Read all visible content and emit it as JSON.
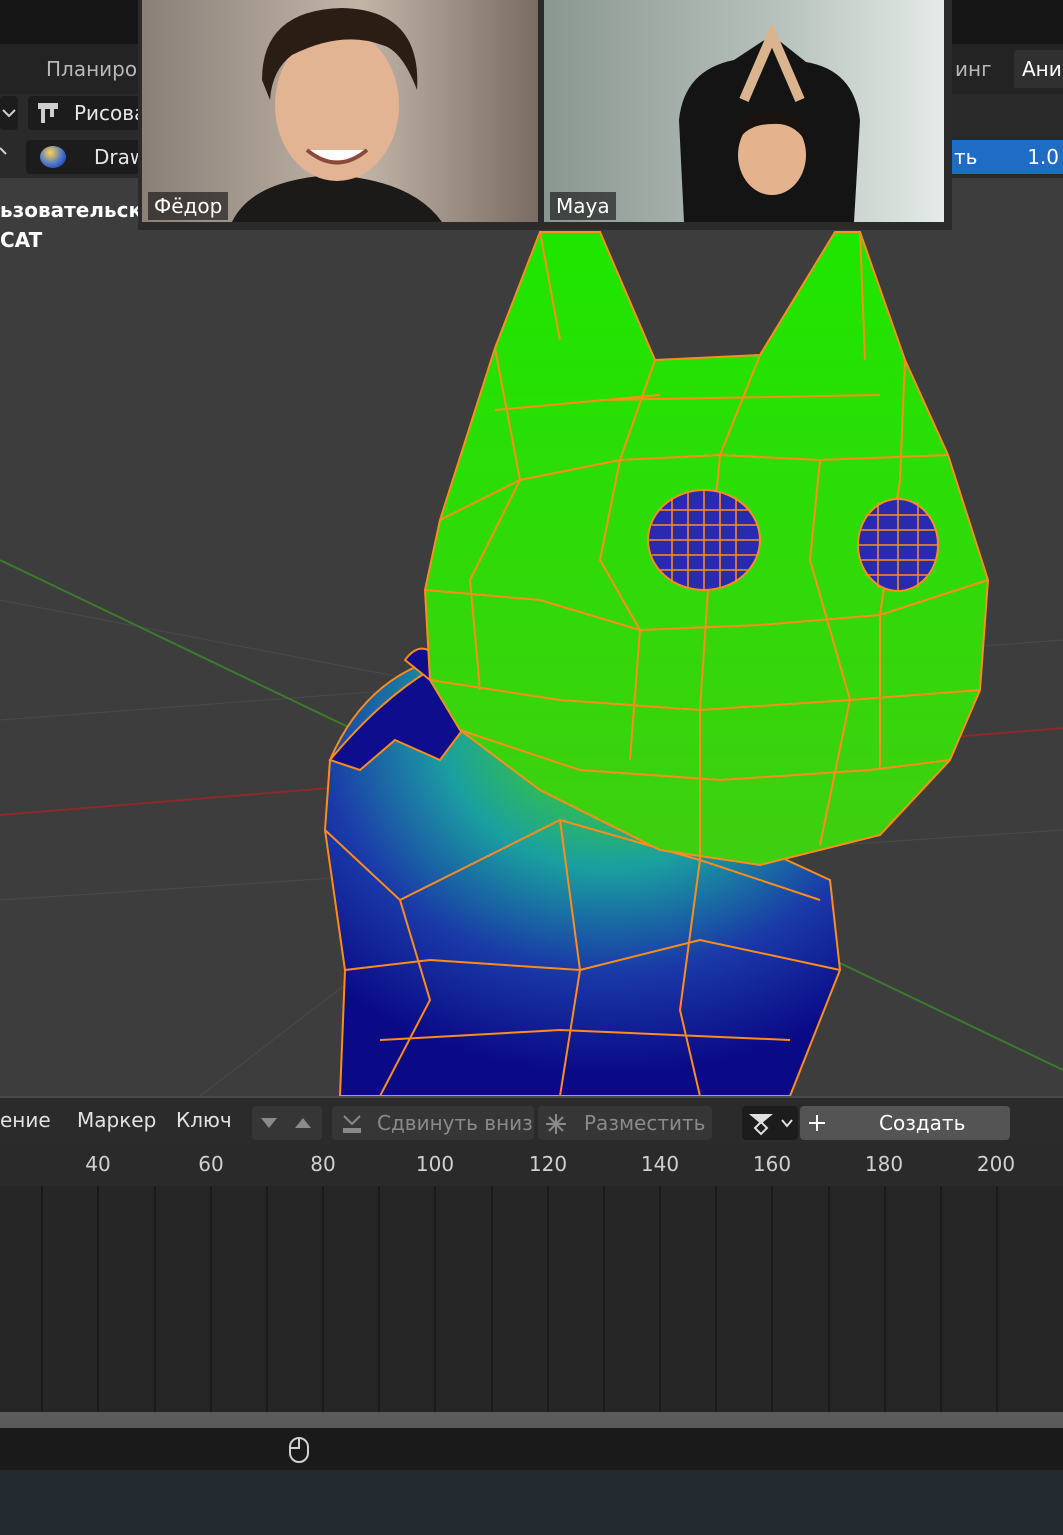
{
  "workspace_tabs": {
    "planning": "Планиров",
    "rigging": "инг",
    "animation": "Ани"
  },
  "header": {
    "draw_mode": "Рисова",
    "brush_name": "Draw",
    "property_label": "ть",
    "property_value": "1.0"
  },
  "viewport": {
    "view_label": "ьзовательска",
    "object_name": "CAT"
  },
  "video_call": {
    "participants": [
      {
        "name": "Фёдор"
      },
      {
        "name": "Maya"
      }
    ]
  },
  "timeline": {
    "menus": {
      "view": "ение",
      "marker": "Маркер",
      "key": "Ключ"
    },
    "buttons": {
      "push_down": "Сдвинуть вниз",
      "stash": "Разместить",
      "new": "Создать"
    },
    "ruler_ticks": [
      "40",
      "60",
      "80",
      "100",
      "120",
      "140",
      "160",
      "180",
      "200"
    ]
  },
  "colors": {
    "weight_high": "#22dd00",
    "weight_low": "#0a0a8a",
    "wire": "#ff8c1a",
    "accent": "#1f6cc5"
  }
}
